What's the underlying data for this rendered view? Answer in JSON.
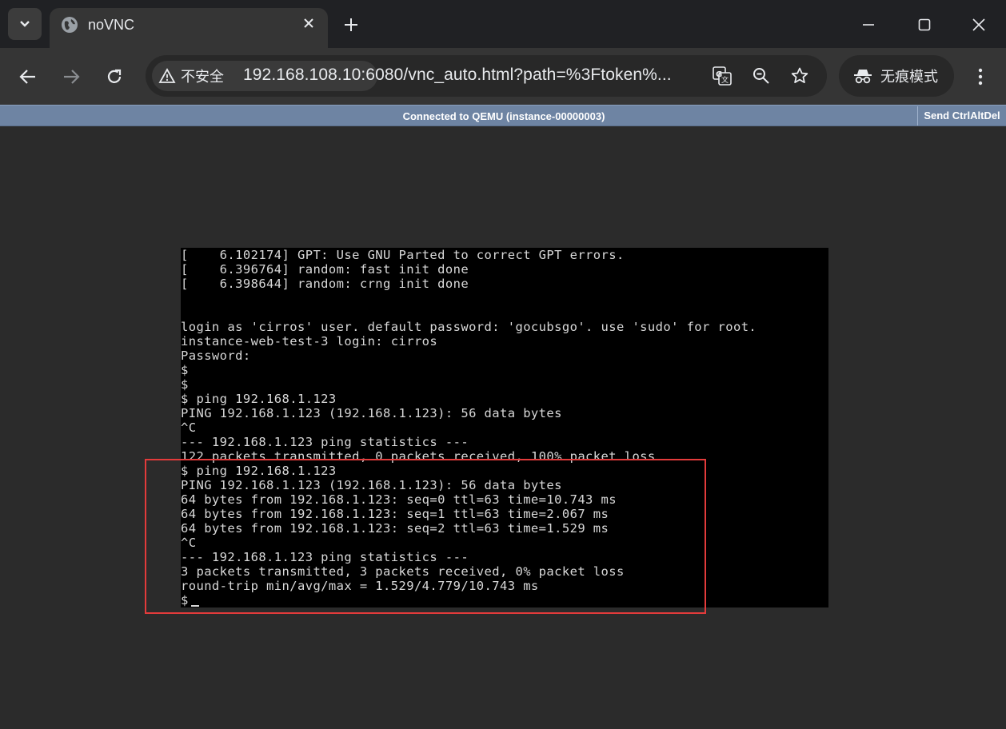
{
  "browser": {
    "tab_title": "noVNC",
    "security_label": "不安全",
    "url": "192.168.108.10:6080/vnc_auto.html?path=%3Ftoken%...",
    "incognito_label": "无痕模式",
    "icons": {
      "tab_search": "chevron-down-icon",
      "favicon": "globe-icon",
      "close_tab": "close-icon",
      "new_tab": "plus-icon",
      "back": "arrow-left-icon",
      "forward": "arrow-right-icon",
      "reload": "reload-icon",
      "security": "warning-triangle-icon",
      "translate": "translate-icon",
      "zoom": "magnifier-icon",
      "bookmark": "star-icon",
      "incognito": "incognito-icon",
      "menu": "kebab-menu-icon"
    }
  },
  "vnc": {
    "status": "Connected to QEMU (instance-00000003)",
    "send_ctrl_alt_del": "Send CtrlAltDel",
    "terminal_lines": [
      "[    6.102174] GPT: Use GNU Parted to correct GPT errors.",
      "[    6.396764] random: fast init done",
      "[    6.398644] random: crng init done",
      "",
      "",
      "login as 'cirros' user. default password: 'gocubsgo'. use 'sudo' for root.",
      "instance-web-test-3 login: cirros",
      "Password:",
      "$",
      "$",
      "$ ping 192.168.1.123",
      "PING 192.168.1.123 (192.168.1.123): 56 data bytes",
      "^C",
      "--- 192.168.1.123 ping statistics ---",
      "122 packets transmitted, 0 packets received, 100% packet loss",
      "$ ping 192.168.1.123",
      "PING 192.168.1.123 (192.168.1.123): 56 data bytes",
      "64 bytes from 192.168.1.123: seq=0 ttl=63 time=10.743 ms",
      "64 bytes from 192.168.1.123: seq=1 ttl=63 time=2.067 ms",
      "64 bytes from 192.168.1.123: seq=2 ttl=63 time=1.529 ms",
      "^C",
      "--- 192.168.1.123 ping statistics ---",
      "3 packets transmitted, 3 packets received, 0% packet loss",
      "round-trip min/avg/max = 1.529/4.779/10.743 ms",
      "$"
    ]
  },
  "colors": {
    "vnc_bar": "#6e84a3",
    "highlight": "#e33b3b",
    "terminal_bg": "#000000",
    "terminal_fg": "#d8d8d8"
  }
}
